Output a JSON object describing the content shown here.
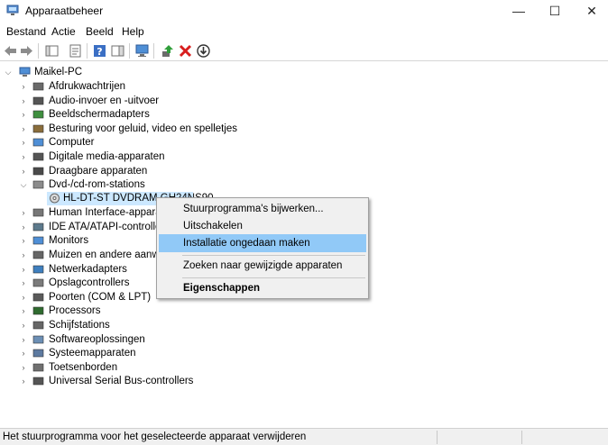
{
  "window": {
    "title": "Apparaatbeheer",
    "minimize": "—",
    "maximize": "☐",
    "close": "✕"
  },
  "menu": [
    "Bestand",
    "Actie",
    "Beeld",
    "Help"
  ],
  "toolbar": {
    "buttons": [
      "back-arrow-icon",
      "forward-arrow-icon",
      "show-hide-console-tree-icon",
      "properties-icon",
      "help-icon",
      "action-pane-icon",
      "monitor-icon",
      "update-driver-icon",
      "uninstall-x-icon",
      "download-icon"
    ]
  },
  "tree": {
    "root": "Maikel-PC",
    "categories": [
      "Afdrukwachtrijen",
      "Audio-invoer en -uitvoer",
      "Beeldschermadapters",
      "Besturing voor geluid, video en spelletjes",
      "Computer",
      "Digitale media-apparaten",
      "Draagbare apparaten",
      "Dvd-/cd-rom-stations",
      "Human Interface-apparate",
      "IDE ATA/ATAPI-controllers",
      "Monitors",
      "Muizen en andere aanwijs",
      "Netwerkadapters",
      "Opslagcontrollers",
      "Poorten (COM & LPT)",
      "Processors",
      "Schijfstations",
      "Softwareoplossingen",
      "Systeemapparaten",
      "Toetsenborden",
      "Universal Serial Bus-controllers"
    ],
    "selected_child": "HL-DT-ST DVDRAM GH24NS90"
  },
  "context_menu": {
    "update": "Stuurprogramma's bijwerken...",
    "disable": "Uitschakelen",
    "uninstall": "Installatie ongedaan maken",
    "scan": "Zoeken naar gewijzigde apparaten",
    "properties": "Eigenschappen"
  },
  "status": {
    "text": "Het stuurprogramma voor het geselecteerde apparaat verwijderen"
  },
  "colors": {
    "selection": "#cce8ff",
    "menu_highlight": "#91c9f7",
    "menu_bg": "#f0f0f0"
  }
}
